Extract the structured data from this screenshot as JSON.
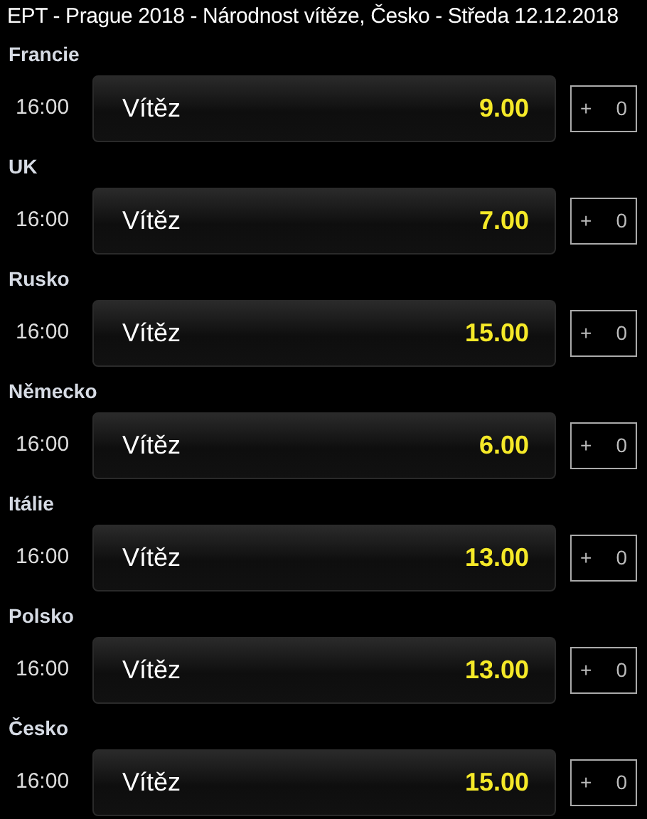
{
  "title": "EPT - Prague 2018 - Národnost vítěze, Česko  - Středa 12.12.2018",
  "events": [
    {
      "country": "Francie",
      "time": "16:00",
      "market": "Vítěz",
      "odds": "9.00",
      "plus": "+",
      "count": "0"
    },
    {
      "country": "UK",
      "time": "16:00",
      "market": "Vítěz",
      "odds": "7.00",
      "plus": "+",
      "count": "0"
    },
    {
      "country": "Rusko",
      "time": "16:00",
      "market": "Vítěz",
      "odds": "15.00",
      "plus": "+",
      "count": "0"
    },
    {
      "country": "Německo",
      "time": "16:00",
      "market": "Vítěz",
      "odds": "6.00",
      "plus": "+",
      "count": "0"
    },
    {
      "country": "Itálie",
      "time": "16:00",
      "market": "Vítěz",
      "odds": "13.00",
      "plus": "+",
      "count": "0"
    },
    {
      "country": "Polsko",
      "time": "16:00",
      "market": "Vítěz",
      "odds": "13.00",
      "plus": "+",
      "count": "0"
    },
    {
      "country": "Česko",
      "time": "16:00",
      "market": "Vítěz",
      "odds": "15.00",
      "plus": "+",
      "count": "0"
    }
  ]
}
